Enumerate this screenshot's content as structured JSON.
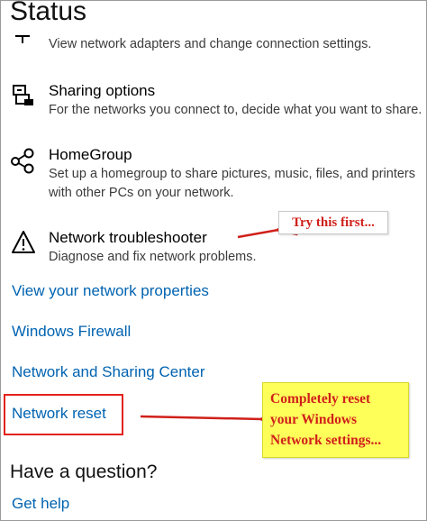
{
  "page": {
    "title": "Status"
  },
  "adapter": {
    "description": "View network adapters and change connection settings."
  },
  "items": [
    {
      "title": "Sharing options",
      "description": "For the networks you connect to, decide what you want to share."
    },
    {
      "title": "HomeGroup",
      "description_lines": [
        "Set up a homegroup to share pictures, music, files, and printers",
        "with other PCs on your network."
      ]
    },
    {
      "title": "Network troubleshooter",
      "description": "Diagnose and fix network problems."
    }
  ],
  "links": {
    "properties": "View your network properties",
    "firewall": "Windows Firewall",
    "sharing_center": "Network and Sharing Center",
    "reset": "Network reset"
  },
  "help": {
    "heading": "Have a question?",
    "link": "Get help"
  },
  "annotations": {
    "callout_top": "Try this first...",
    "callout_bottom_lines": [
      "Completely reset",
      "your Windows",
      "Network settings..."
    ]
  },
  "colors": {
    "link": "#0063b1",
    "annotation_text": "#d0201a",
    "annotation_box": "#e2231a",
    "highlight": "#ffff5a"
  }
}
